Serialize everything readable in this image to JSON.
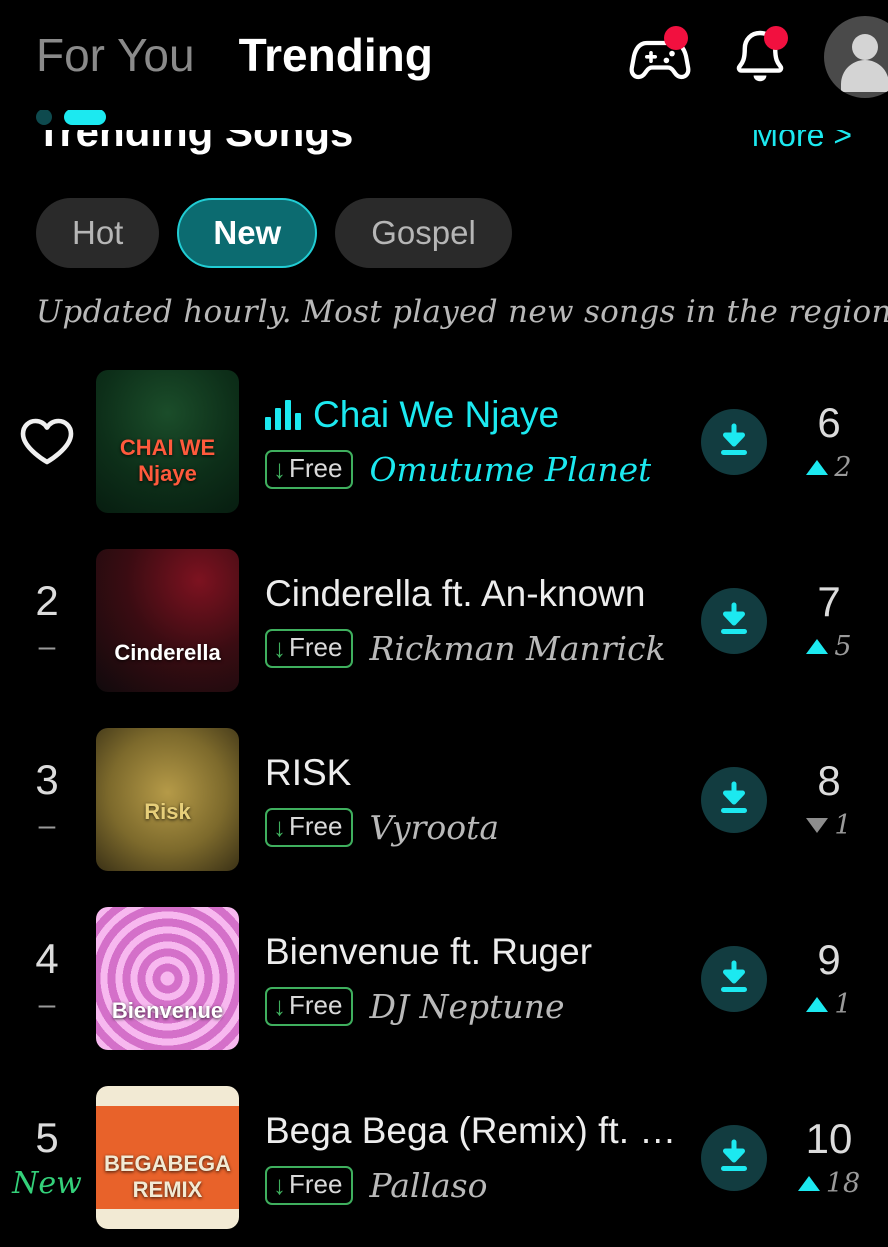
{
  "header": {
    "tabs": [
      {
        "label": "For You",
        "active": false
      },
      {
        "label": "Trending",
        "active": true
      }
    ],
    "icons": {
      "gamepad": "gamepad-icon",
      "bell": "bell-icon",
      "avatar": "avatar"
    }
  },
  "pager": {
    "dots": 2,
    "active_index": 1
  },
  "section": {
    "title": "Trending Songs",
    "more_label": "More >"
  },
  "filters": [
    {
      "label": "Hot",
      "active": false
    },
    {
      "label": "New",
      "active": true
    },
    {
      "label": "Gospel",
      "active": false
    }
  ],
  "subtitle": "Updated hourly. Most played new songs in the region.",
  "colors": {
    "accent_cyan": "#1ce9f0",
    "pill_active_bg": "#0c6b70",
    "free_green": "#3faf5e",
    "new_green": "#34d17a",
    "badge_red": "#f2103f",
    "background": "#000000"
  },
  "songs": [
    {
      "rank": "",
      "rank_icon": "heart-icon",
      "rank_delta": "",
      "delta_type": "none",
      "title": "Chai We Njaye",
      "artist": "Omutume Planet",
      "free_label": "Free",
      "playing": true,
      "stat_number": "6",
      "stat_change": "2",
      "stat_direction": "up",
      "art_label": "CHAI WE Njaye",
      "art_style": "green"
    },
    {
      "rank": "2",
      "rank_icon": "",
      "rank_delta": "–",
      "delta_type": "same",
      "title": "Cinderella ft. An-known",
      "artist": "Rickman Manrick",
      "free_label": "Free",
      "playing": false,
      "stat_number": "7",
      "stat_change": "5",
      "stat_direction": "up",
      "art_label": "Cinderella",
      "art_style": "red"
    },
    {
      "rank": "3",
      "rank_icon": "",
      "rank_delta": "–",
      "delta_type": "same",
      "title": "RISK",
      "artist": "Vyroota",
      "free_label": "Free",
      "playing": false,
      "stat_number": "8",
      "stat_change": "1",
      "stat_direction": "down",
      "art_label": "Risk",
      "art_style": "gold"
    },
    {
      "rank": "4",
      "rank_icon": "",
      "rank_delta": "–",
      "delta_type": "same",
      "title": "Bienvenue ft. Ruger",
      "artist": "DJ Neptune",
      "free_label": "Free",
      "playing": false,
      "stat_number": "9",
      "stat_change": "1",
      "stat_direction": "up",
      "art_label": "Bienvenue",
      "art_style": "pink"
    },
    {
      "rank": "5",
      "rank_icon": "",
      "rank_delta": "New",
      "delta_type": "new",
      "title": "Bega Bega (Remix) ft. Jose c...",
      "artist": "Pallaso",
      "free_label": "Free",
      "playing": false,
      "stat_number": "10",
      "stat_change": "18",
      "stat_direction": "up",
      "art_label": "BEGABEGA REMIX",
      "art_style": "orange"
    }
  ]
}
